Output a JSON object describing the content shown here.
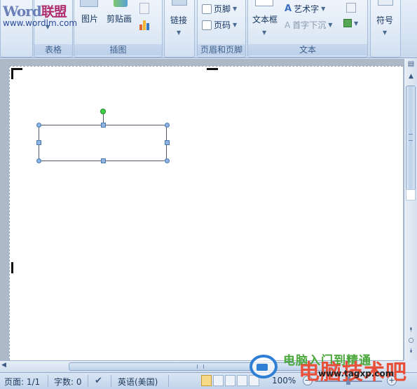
{
  "watermark": {
    "logo_latin": "Word",
    "logo_cn": "联盟",
    "url": "www.wordlm.com"
  },
  "ribbon": {
    "groups": {
      "table": {
        "label": "表格"
      },
      "illustrations": {
        "label": "插图",
        "picture": "图片",
        "clipart": "剪贴画"
      },
      "links": {
        "label": "链接"
      },
      "header_footer": {
        "label": "页眉和页脚",
        "footer": "页脚",
        "page_number": "页码"
      },
      "text": {
        "label": "文本",
        "textbox": "文本框",
        "wordart": "艺术字",
        "dropcap": "首字下沉"
      },
      "symbols": {
        "label": "符号"
      }
    }
  },
  "status": {
    "page": "页面: 1/1",
    "words": "字数: 0",
    "language": "英语(美国)",
    "zoom": "100%"
  },
  "overlay": {
    "text1": "电脑入门到精通",
    "text2": "电脑技术吧",
    "url": "www.tagxp.com"
  },
  "colors": {
    "ribbon_bg": "#d7e4f3",
    "page": "#ffffff",
    "handle": "#8db4e2",
    "rotate_handle": "#3fd04a"
  }
}
